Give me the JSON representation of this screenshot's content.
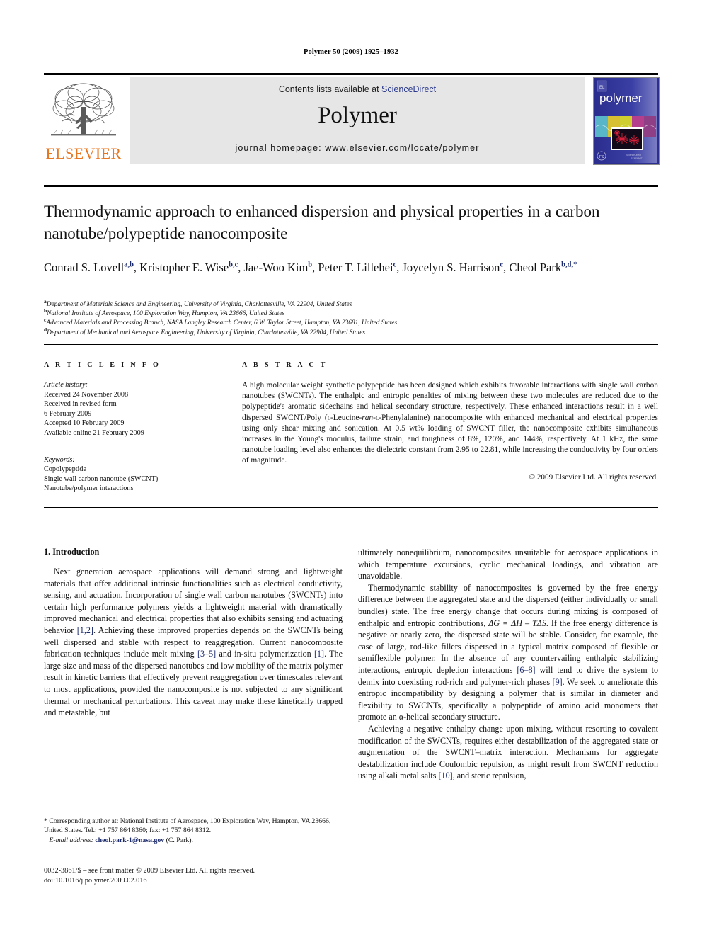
{
  "running_head": "Polymer 50 (2009) 1925–1932",
  "masthead": {
    "contents_prefix": "Contents lists available at ",
    "sciencedirect": "ScienceDirect",
    "journal_name": "Polymer",
    "homepage": "journal homepage: www.elsevier.com/locate/polymer",
    "publisher_logo_text": "ELSEVIER",
    "cover_title": "polymer"
  },
  "article": {
    "title": "Thermodynamic approach to enhanced dispersion and physical properties in a carbon nanotube/polypeptide nanocomposite",
    "authors_html": "Conrad S. Lovell<sup>a,b</sup>, Kristopher E. Wise<sup>b,c</sup>, Jae-Woo Kim<sup>b</sup>, Peter T. Lillehei<sup>c</sup>, Joycelyn S. Harrison<sup>c</sup>, Cheol Park<sup>b,d,</sup><sup>*</sup>",
    "affiliations": [
      {
        "marker": "a",
        "text": "Department of Materials Science and Engineering, University of Virginia, Charlottesville, VA 22904, United States"
      },
      {
        "marker": "b",
        "text": "National Institute of Aerospace, 100 Exploration Way, Hampton, VA 23666, United States"
      },
      {
        "marker": "c",
        "text": "Advanced Materials and Processing Branch, NASA Langley Research Center, 6 W. Taylor Street, Hampton, VA 23681, United States"
      },
      {
        "marker": "d",
        "text": "Department of Mechanical and Aerospace Engineering, University of Virginia, Charlottesville, VA 22904, United States"
      }
    ]
  },
  "article_info": {
    "heading": "A R T I C L E    I N F O",
    "history_label": "Article history:",
    "history": [
      "Received 24 November 2008",
      "Received in revised form",
      "6 February 2009",
      "Accepted 10 February 2009",
      "Available online 21 February 2009"
    ],
    "keywords_label": "Keywords:",
    "keywords": [
      "Copolypeptide",
      "Single wall carbon nanotube (SWCNT)",
      "Nanotube/polymer interactions"
    ]
  },
  "abstract": {
    "heading": "A B S T R A C T",
    "text_part1": "A high molecular weight synthetic polypeptide has been designed which exhibits favorable interactions with single wall carbon nanotubes (SWCNTs). The enthalpic and entropic penalties of mixing between these two molecules are reduced due to the polypeptide's aromatic sidechains and helical secondary structure, respectively. These enhanced interactions result in a well dispersed SWCNT/Poly (",
    "lleucine_sc": "l",
    "text_part2": "-Leucine-",
    "ran_ital": "ran",
    "text_part3": "-",
    "lphe_sc": "l",
    "text_part4": "-Phenylalanine) nanocomposite with enhanced mechanical and electrical properties using only shear mixing and sonication. At 0.5 wt% loading of SWCNT filler, the nanocomposite exhibits simultaneous increases in the Young's modulus, failure strain, and toughness of 8%, 120%, and 144%, respectively. At 1 kHz, the same nanotube loading level also enhances the dielectric constant from 2.95 to 22.81, while increasing the conductivity by four orders of magnitude.",
    "copyright": "© 2009 Elsevier Ltd. All rights reserved."
  },
  "body": {
    "section_title": "1. Introduction",
    "left_p1_a": "Next generation aerospace applications will demand strong and lightweight materials that offer additional intrinsic functionalities such as electrical conductivity, sensing, and actuation. Incorporation of single wall carbon nanotubes (SWCNTs) into certain high performance polymers yields a lightweight material with dramatically improved mechanical and electrical properties that also exhibits sensing and actuating behavior ",
    "ref_12": "[1,2]",
    "left_p1_b": ". Achieving these improved properties depends on the SWCNTs being well dispersed and stable with respect to reaggregation. Current nanocomposite fabrication techniques include melt mixing ",
    "ref_35": "[3–5]",
    "left_p1_c": " and in-situ polymerization ",
    "ref_1": "[1]",
    "left_p1_d": ". The large size and mass of the dispersed nanotubes and low mobility of the matrix polymer result in kinetic barriers that effectively prevent reaggregation over timescales relevant to most applications, provided the nanocomposite is not subjected to any significant thermal or mechanical perturbations. This caveat may make these kinetically trapped and metastable, but",
    "right_p1_cont": "ultimately nonequilibrium, nanocomposites unsuitable for aerospace applications in which temperature excursions, cyclic mechanical loadings, and vibration are unavoidable.",
    "right_p2_a": "Thermodynamic stability of nanocomposites is governed by the free energy difference between the aggregated state and the dispersed (either individually or small bundles) state. The free energy change that occurs during mixing is composed of enthalpic and entropic contributions, ",
    "eq_dg": "ΔG = ΔH – TΔS",
    "right_p2_b": ". If the free energy difference is negative or nearly zero, the dispersed state will be stable. Consider, for example, the case of large, rod-like fillers dispersed in a typical matrix composed of flexible or semiflexible polymer. In the absence of any countervailing enthalpic stabilizing interactions, entropic depletion interactions ",
    "ref_68": "[6–8]",
    "right_p2_c": " will tend to drive the system to demix into coexisting rod-rich and polymer-rich phases ",
    "ref_9": "[9]",
    "right_p2_d": ". We seek to ameliorate this entropic incompatibility by designing a polymer that is similar in diameter and flexibility to SWCNTs, specifically a polypeptide of amino acid monomers that promote an α-helical secondary structure.",
    "right_p3_a": "Achieving a negative enthalpy change upon mixing, without resorting to covalent modification of the SWCNTs, requires either destabilization of the aggregated state or augmentation of the SWCNT–matrix interaction. Mechanisms for aggregate destabilization include Coulombic repulsion, as might result from SWCNT reduction using alkali metal salts ",
    "ref_10": "[10]",
    "right_p3_b": ", and steric repulsion,"
  },
  "footer": {
    "corresponding_marker": "*",
    "corresponding_text": " Corresponding author at: National Institute of Aerospace, 100 Exploration Way, Hampton, VA 23666, United States. Tel.: +1 757 864 8360; fax: +1 757 864 8312.",
    "email_label": "E-mail address:",
    "email": "cheol.park-1@nasa.gov",
    "email_suffix": " (C. Park).",
    "issn_line": "0032-3861/$ – see front matter © 2009 Elsevier Ltd. All rights reserved.",
    "doi_line": "doi:10.1016/j.polymer.2009.02.016"
  },
  "colors": {
    "link": "#2b3a8f",
    "ref": "#1b2a6b",
    "elsevier_orange": "#E87722",
    "band_gray": "#e6e6e6"
  }
}
